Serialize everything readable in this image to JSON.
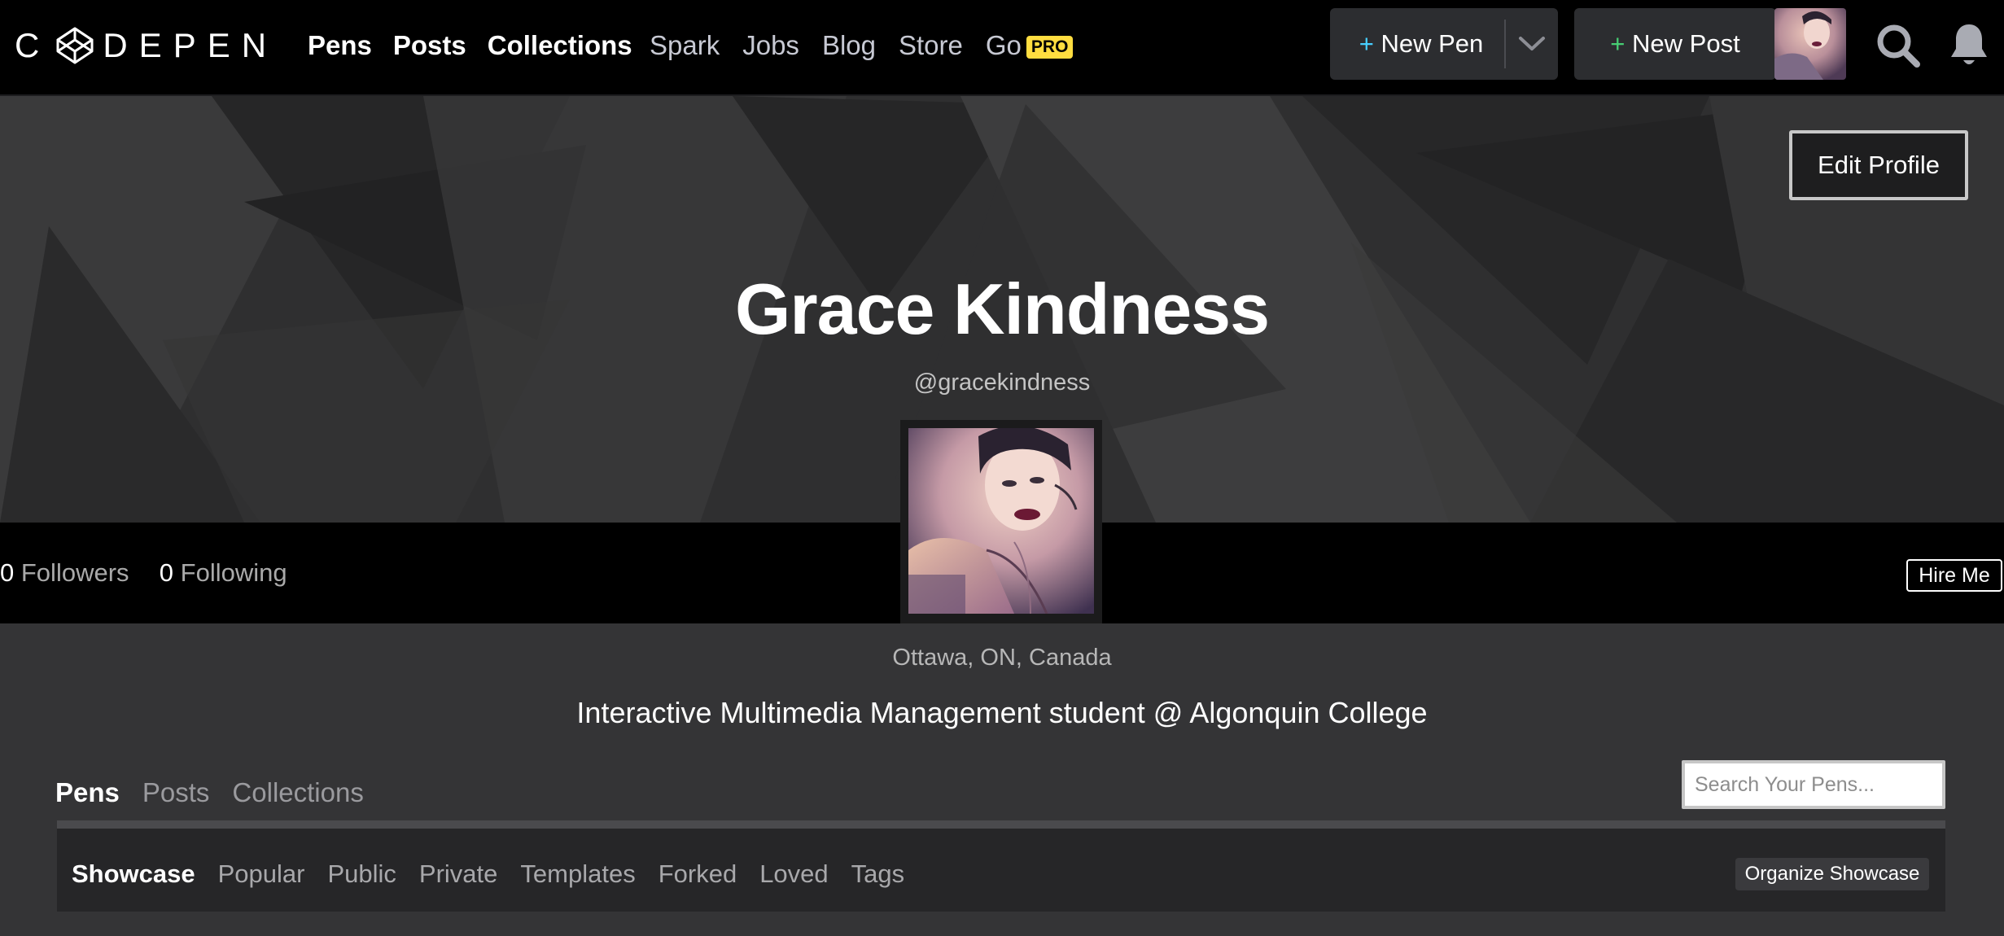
{
  "header": {
    "logo_text": "CODEPEN",
    "logo_left": "C",
    "logo_right": "DEPEN",
    "nav_primary": [
      "Pens",
      "Posts",
      "Collections"
    ],
    "nav_secondary": [
      "Spark",
      "Jobs",
      "Blog",
      "Store",
      "Go"
    ],
    "pro_badge": "PRO",
    "new_pen_label": "New Pen",
    "new_post_label": "New Post",
    "plus": "+"
  },
  "profile": {
    "name": "Grace Kindness",
    "handle": "@gracekindness",
    "edit_button": "Edit Profile",
    "followers_count": "0",
    "followers_label": "Followers",
    "following_count": "0",
    "following_label": "Following",
    "hire_button": "Hire Me",
    "location": "Ottawa, ON, Canada",
    "bio": "Interactive Multimedia Management student @ Algonquin College"
  },
  "content_tabs": {
    "tabs": [
      "Pens",
      "Posts",
      "Collections"
    ],
    "active": "Pens",
    "search_placeholder": "Search Your Pens...",
    "subtabs": [
      "Showcase",
      "Popular",
      "Public",
      "Private",
      "Templates",
      "Forked",
      "Loved",
      "Tags"
    ],
    "active_subtab": "Showcase",
    "organize_button": "Organize Showcase"
  },
  "colors": {
    "accent_blue": "#47cfff",
    "accent_green": "#47cf73",
    "pro_yellow": "#ffdd40"
  }
}
